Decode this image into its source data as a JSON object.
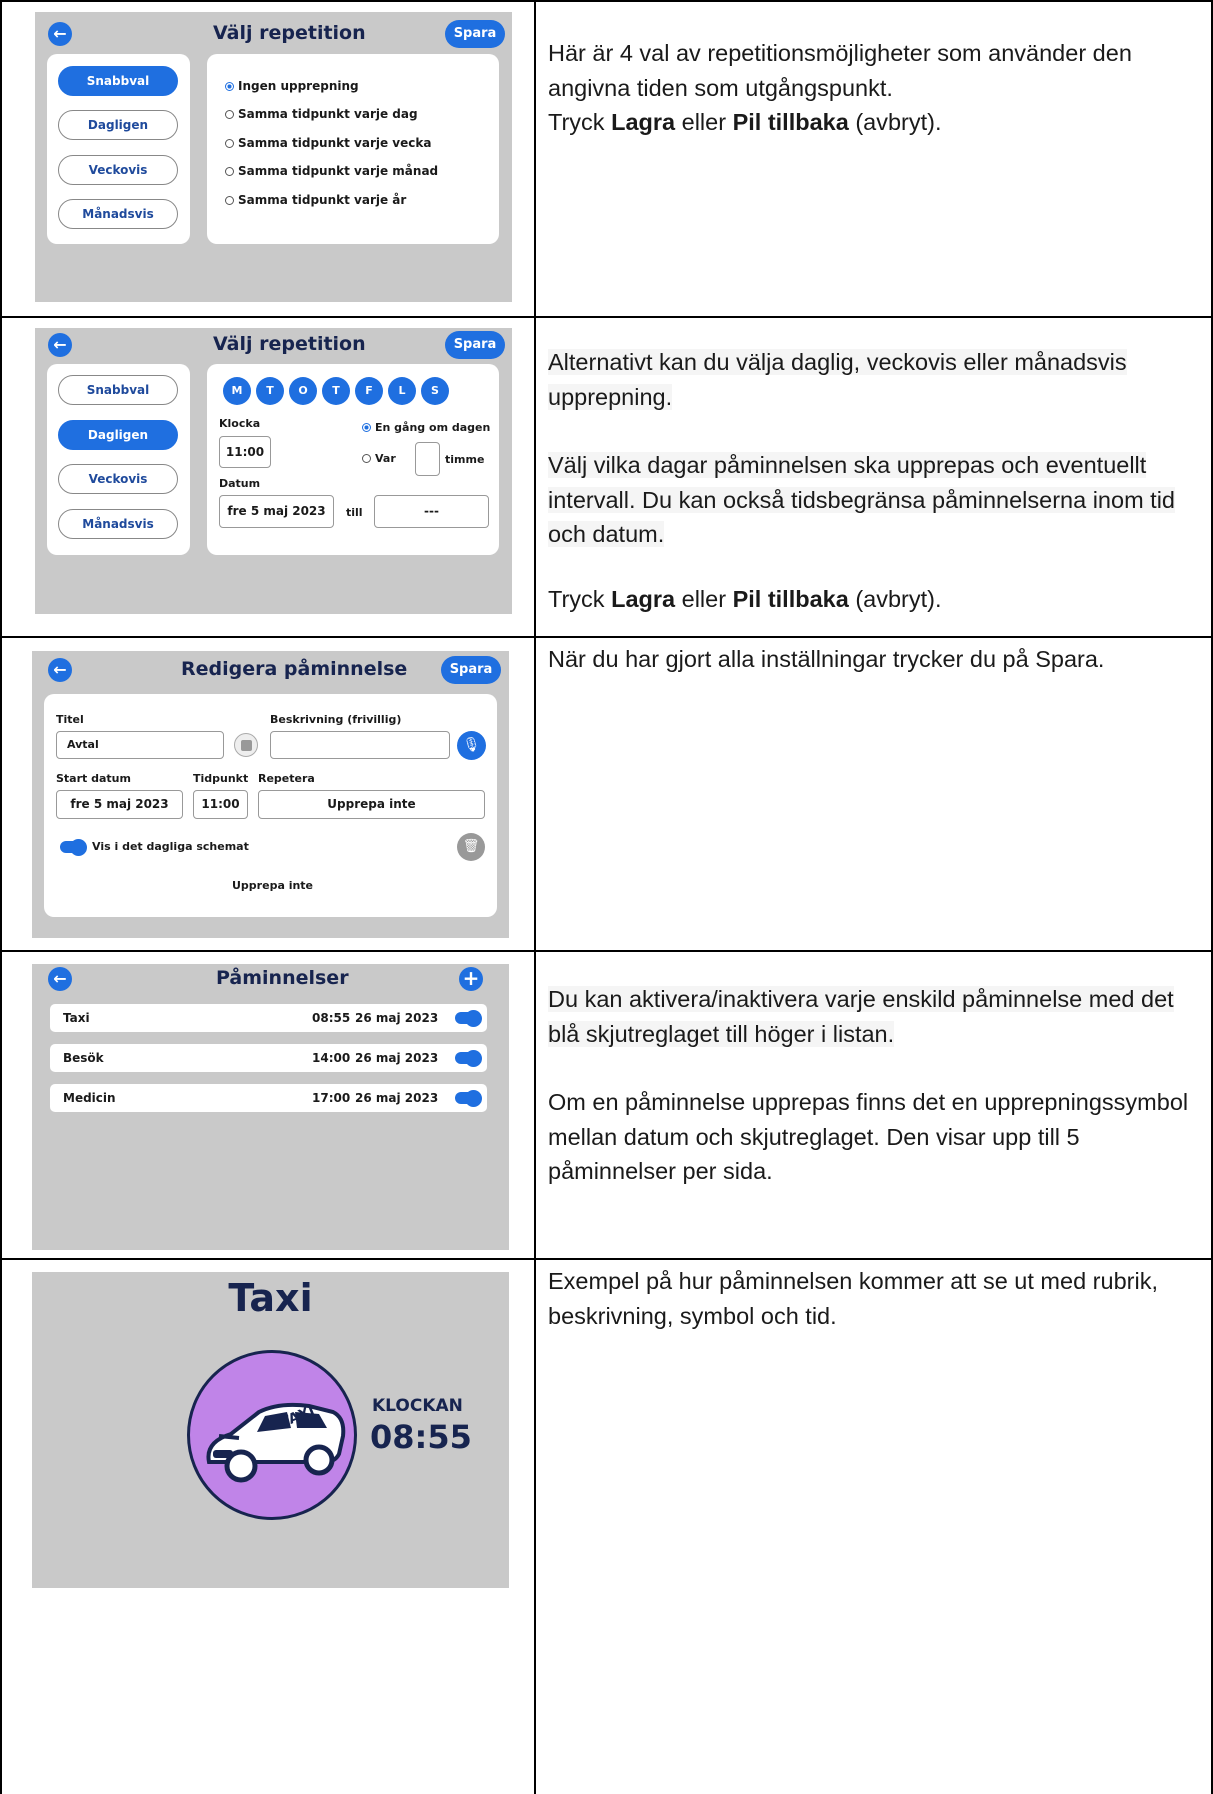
{
  "row1": {
    "screen": {
      "title": "Välj repetition",
      "save": "Spara",
      "tabs": [
        "Snabbval",
        "Dagligen",
        "Veckovis",
        "Månadsvis"
      ],
      "options": [
        "Ingen upprepning",
        "Samma tidpunkt varje dag",
        "Samma tidpunkt varje vecka",
        "Samma tidpunkt varje månad",
        "Samma tidpunkt varje år"
      ]
    },
    "text": {
      "line1": "Här är 4 val av repetitionsmöjligheter som använder den angivna tiden som utgångspunkt.",
      "press": "Tryck ",
      "save_word": "Lagra",
      "or": " eller ",
      "back_word": "Pil tillbaka",
      "cancel": " (avbryt)."
    }
  },
  "row2": {
    "screen": {
      "title": "Välj repetition",
      "save": "Spara",
      "tabs": [
        "Snabbval",
        "Dagligen",
        "Veckovis",
        "Månadsvis"
      ],
      "days": [
        "M",
        "T",
        "O",
        "T",
        "F",
        "L",
        "S"
      ],
      "clock_label": "Klocka",
      "clock_value": "11:00",
      "once_label": "En gång om dagen",
      "every_label": "Var",
      "hour_label": "timme",
      "date_label": "Datum",
      "date_value": "fre 5 maj 2023",
      "until_label": "till",
      "until_value": "---"
    },
    "text": {
      "para1": "Alternativt kan du välja daglig, veckovis eller månadsvis upprepning.",
      "para2": "Välj vilka dagar påminnelsen ska upprepas och eventuellt intervall. Du kan också tidsbegränsa påminnelserna inom tid och datum.",
      "press": "Tryck ",
      "save_word": "Lagra",
      "or": " eller ",
      "back_word": "Pil tillbaka",
      "cancel": " (avbryt)."
    }
  },
  "row3": {
    "screen": {
      "title": "Redigera påminnelse",
      "save": "Spara",
      "title_label": "Titel",
      "title_value": "Avtal",
      "desc_label": "Beskrivning (frivillig)",
      "start_label": "Start datum",
      "start_value": "fre 5 maj 2023",
      "time_label": "Tidpunkt",
      "time_value": "11:00",
      "repeat_label": "Repetera",
      "repeat_value": "Upprepa inte",
      "schedule_label": "Vis i det dagliga schemat",
      "footer": "Upprepa inte"
    },
    "text": {
      "para1": "När du har gjort alla inställningar trycker du på Spara."
    }
  },
  "row4": {
    "screen": {
      "title": "Påminnelser",
      "items": [
        {
          "name": "Taxi",
          "time": "08:55",
          "date": "26 maj 2023"
        },
        {
          "name": "Besök",
          "time": "14:00",
          "date": "26 maj 2023"
        },
        {
          "name": "Medicin",
          "time": "17:00",
          "date": "26 maj 2023"
        }
      ]
    },
    "text": {
      "para1": "Du kan aktivera/inaktivera varje enskild påminnelse med det blå skjutreglaget till höger i listan.",
      "para2": "Om en påminnelse upprepas finns det en upprepningssymbol mellan datum och skjutreglaget. Den visar upp till 5 påminnelser per sida."
    }
  },
  "row5": {
    "screen": {
      "title": "Taxi",
      "clock_label": "KLOCKAN",
      "time": "08:55",
      "sign": "TAXI"
    },
    "text": {
      "para1": "Exempel på hur påminnelsen kommer att se ut med rubrik, beskrivning, symbol och tid."
    }
  },
  "colors": {
    "accent": "#1f6fe0",
    "title": "#17244f",
    "screen_bg": "#c9c9c9",
    "taxi_circle": "#c084e8"
  }
}
